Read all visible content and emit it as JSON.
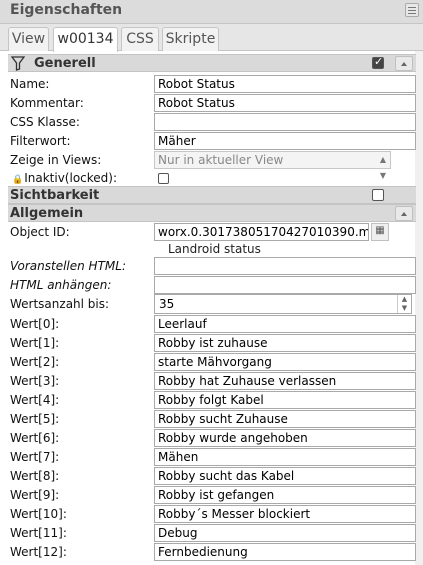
{
  "header": {
    "title": "Eigenschaften"
  },
  "tabs": [
    {
      "label": "View",
      "active": false
    },
    {
      "label": "w00134",
      "active": true
    },
    {
      "label": "CSS",
      "active": false
    },
    {
      "label": "Skripte",
      "active": false
    }
  ],
  "generell": {
    "label": "Generell",
    "checked": true,
    "fields": {
      "name": {
        "label": "Name:",
        "value": "Robot Status"
      },
      "kommentar": {
        "label": "Kommentar:",
        "value": "Robot Status"
      },
      "css_klasse": {
        "label": "CSS Klasse:",
        "value": ""
      },
      "filterwort": {
        "label": "Filterwort:",
        "value": "Mäher"
      },
      "zeige_in_views": {
        "label": "Zeige in Views:",
        "value": "Nur in aktueller View"
      },
      "inaktiv": {
        "label": "Inaktiv(locked):",
        "checked": false
      }
    }
  },
  "sichtbarkeit": {
    "label": "Sichtbarkeit",
    "checked": false
  },
  "allgemein": {
    "label": "Allgemein",
    "object_id": {
      "label": "Object ID:",
      "value": "worx.0.30173805170427010390.m",
      "description": "Landroid status"
    },
    "voranstellen": {
      "label": "Voranstellen HTML:",
      "value": ""
    },
    "anhaengen": {
      "label": "HTML anhängen:",
      "value": ""
    },
    "wertsanzahl": {
      "label": "Wertsanzahl bis:",
      "value": "35"
    },
    "werte": [
      {
        "label": "Wert[0]:",
        "value": "Leerlauf"
      },
      {
        "label": "Wert[1]:",
        "value": "Robby ist zuhause"
      },
      {
        "label": "Wert[2]:",
        "value": "starte Mähvorgang"
      },
      {
        "label": "Wert[3]:",
        "value": "Robby hat Zuhause verlassen"
      },
      {
        "label": "Wert[4]:",
        "value": "Robby folgt Kabel"
      },
      {
        "label": "Wert[5]:",
        "value": "Robby sucht Zuhause"
      },
      {
        "label": "Wert[6]:",
        "value": "Robby wurde angehoben"
      },
      {
        "label": "Wert[7]:",
        "value": "Mähen"
      },
      {
        "label": "Wert[8]:",
        "value": "Robby sucht das Kabel"
      },
      {
        "label": "Wert[9]:",
        "value": "Robby ist gefangen"
      },
      {
        "label": "Wert[10]:",
        "value": "Robby´s Messer blockiert"
      },
      {
        "label": "Wert[11]:",
        "value": "Debug"
      },
      {
        "label": "Wert[12]:",
        "value": "Fernbedienung"
      }
    ]
  }
}
